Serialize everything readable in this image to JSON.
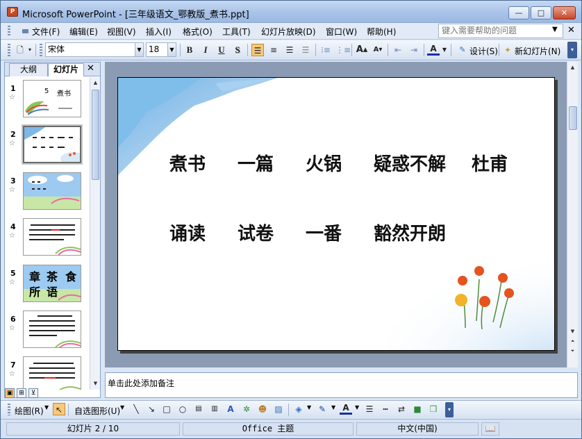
{
  "window": {
    "title": "Microsoft PowerPoint - [三年级语文_鄂教版_煮书.ppt]",
    "app_icon_label": "P",
    "min_glyph": "—",
    "max_glyph": "□",
    "close_glyph": "✕"
  },
  "menu": {
    "items": [
      "文件(F)",
      "编辑(E)",
      "视图(V)",
      "插入(I)",
      "格式(O)",
      "工具(T)",
      "幻灯片放映(D)",
      "窗口(W)",
      "帮助(H)"
    ],
    "help_placeholder": "键入需要帮助的问题",
    "close_glyph": "✕"
  },
  "toolbar": {
    "font_name": "宋体",
    "font_size": "18",
    "bold": "B",
    "italic": "I",
    "underline": "U",
    "shadow": "S",
    "design_label": "设计(S)",
    "new_slide_label": "新幻灯片(N)"
  },
  "left_panel": {
    "tab_outline": "大纲",
    "tab_slides": "幻灯片",
    "close_glyph": "✕",
    "slide_numbers": [
      "1",
      "2",
      "3",
      "4",
      "5",
      "6",
      "7"
    ],
    "selected_slide": 2,
    "thumb1_num": "5",
    "thumb1_title": "煮书",
    "thumb5_chars": [
      "章",
      "茶",
      "食",
      "所",
      "语"
    ]
  },
  "slide": {
    "row1": [
      "煮书",
      "一篇",
      "火锅",
      "疑惑不解",
      "杜甫"
    ],
    "row2": [
      "诵读",
      "试卷",
      "一番",
      "豁然开朗"
    ]
  },
  "notes": {
    "placeholder": "单击此处添加备注"
  },
  "drawbar": {
    "draw_label": "绘图(R)",
    "autoshape_label": "自选图形(U)"
  },
  "status": {
    "slide_pos": "幻灯片 2 / 10",
    "theme": "Office 主题",
    "language": "中文(中国)"
  }
}
